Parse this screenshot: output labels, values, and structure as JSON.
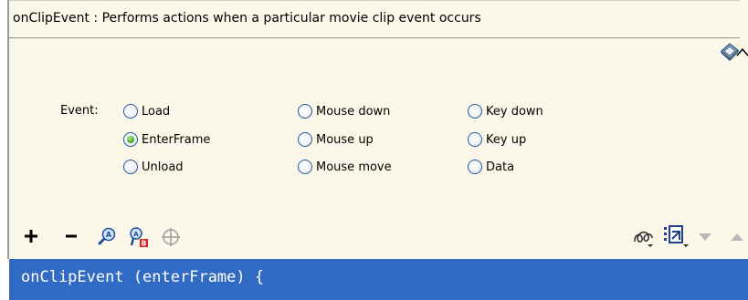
{
  "description": {
    "text": "onClipEvent : Performs actions when a particular movie clip event occurs"
  },
  "event_group": {
    "label": "Event:",
    "options": [
      {
        "label": "Load",
        "checked": false
      },
      {
        "label": "EnterFrame",
        "checked": true
      },
      {
        "label": "Unload",
        "checked": false
      },
      {
        "label": "Mouse down",
        "checked": false
      },
      {
        "label": "Mouse up",
        "checked": false
      },
      {
        "label": "Mouse move",
        "checked": false
      },
      {
        "label": "Key down",
        "checked": false
      },
      {
        "label": "Key up",
        "checked": false
      },
      {
        "label": "Data",
        "checked": false
      }
    ]
  },
  "toolbar": {
    "icons": [
      "add-icon",
      "remove-icon",
      "find-icon",
      "replace-icon",
      "insert-target-path-icon",
      "debug-options-icon",
      "view-options-icon",
      "move-down-icon",
      "move-up-icon"
    ]
  },
  "code": {
    "line": "onClipEvent (enterFrame) {"
  },
  "colors": {
    "panel_bg": "#fbf8ea",
    "selection_bg": "#316ac5",
    "radio_checked": "#3fae2b"
  }
}
